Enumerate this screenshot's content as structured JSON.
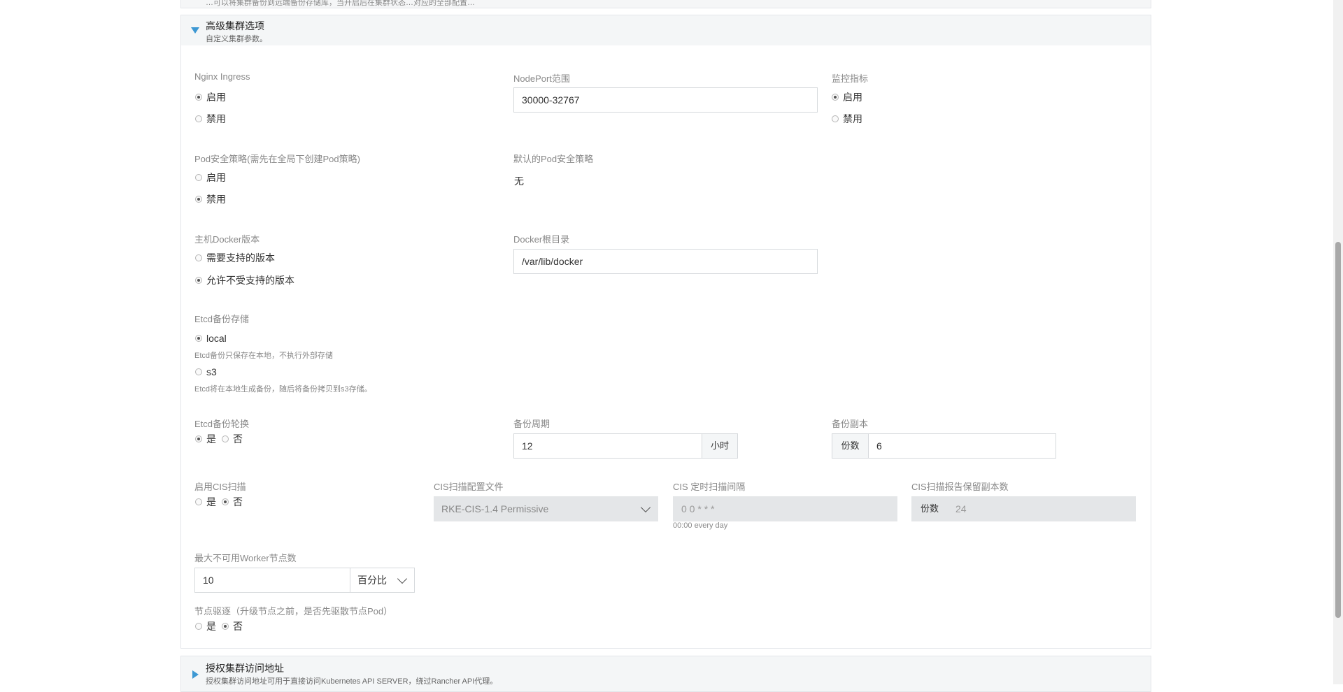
{
  "top_section": {
    "subtitle_partial": "…可以将集群备份到远端备份存储库，当开启后在集群状态…对应的全部配置…"
  },
  "advanced": {
    "title": "高级集群选项",
    "subtitle": "自定义集群参数。"
  },
  "nginx_ingress": {
    "label": "Nginx Ingress",
    "options": [
      "启用",
      "禁用"
    ],
    "selected": "启用"
  },
  "nodeport": {
    "label": "NodePort范围",
    "value": "30000-32767"
  },
  "monitoring": {
    "label": "监控指标",
    "options": [
      "启用",
      "禁用"
    ],
    "selected": "启用"
  },
  "pod_security": {
    "label": "Pod安全策略(需先在全局下创建Pod策略)",
    "options": [
      "启用",
      "禁用"
    ],
    "selected": "禁用"
  },
  "default_psp": {
    "label": "默认的Pod安全策略",
    "value": "无"
  },
  "docker_version": {
    "label": "主机Docker版本",
    "options": [
      "需要支持的版本",
      "允许不受支持的版本"
    ],
    "selected": "允许不受支持的版本"
  },
  "docker_root": {
    "label": "Docker根目录",
    "value": "/var/lib/docker"
  },
  "etcd_storage": {
    "label": "Etcd备份存储",
    "local": "local",
    "local_help": "Etcd备份只保存在本地，不执行外部存储",
    "s3": "s3",
    "s3_help": "Etcd将在本地生成备份，随后将备份拷贝到s3存储。",
    "selected": "local"
  },
  "etcd_rotate": {
    "label": "Etcd备份轮换",
    "yes": "是",
    "no": "否",
    "selected": "是"
  },
  "backup_period": {
    "label": "备份周期",
    "value": "12",
    "unit": "小时"
  },
  "backup_copies": {
    "label": "备份副本",
    "prefix": "份数",
    "value": "6"
  },
  "cis_enable": {
    "label": "启用CIS扫描",
    "yes": "是",
    "no": "否",
    "selected": "否"
  },
  "cis_profile": {
    "label": "CIS扫描配置文件",
    "value": "RKE-CIS-1.4 Permissive"
  },
  "cis_interval": {
    "label": "CIS 定时扫描间隔",
    "value": "0 0 * * *",
    "help": "00:00 every day"
  },
  "cis_retention": {
    "label": "CIS扫描报告保留副本数",
    "prefix": "份数",
    "value": "24"
  },
  "max_unavailable": {
    "label": "最大不可用Worker节点数",
    "value": "10",
    "unit": "百分比"
  },
  "drain": {
    "label": "节点驱逐（升级节点之前，是否先驱散节点Pod）",
    "yes": "是",
    "no": "否",
    "selected": "否"
  },
  "auth_endpoint": {
    "title": "授权集群访问地址",
    "subtitle": "授权集群访问地址可用于直接访问Kubernetes API SERVER，绕过Rancher API代理。"
  }
}
